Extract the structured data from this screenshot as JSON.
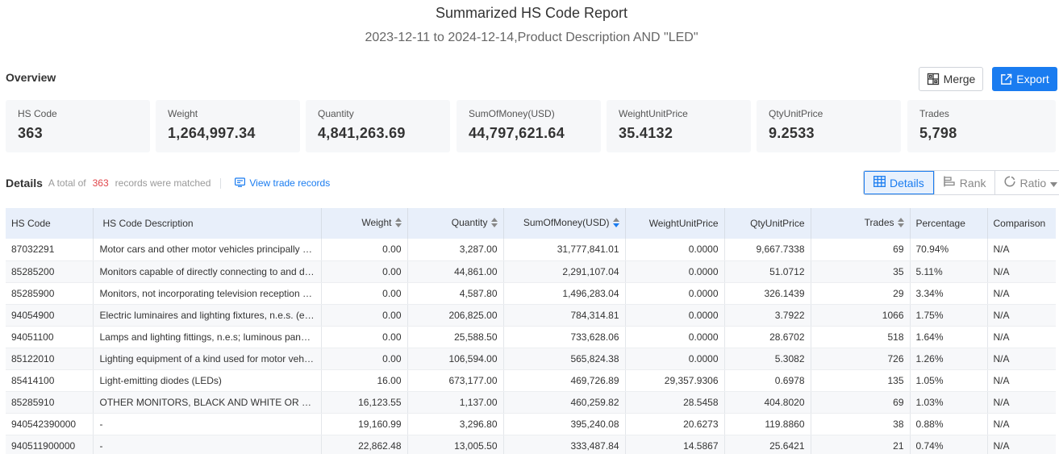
{
  "header": {
    "title": "Summarized HS Code Report",
    "subtitle": "2023-12-11 to 2024-12-14,Product Description AND \"LED\""
  },
  "overview": {
    "label": "Overview",
    "merge_label": "Merge",
    "export_label": "Export",
    "cards": [
      {
        "label": "HS Code",
        "value": "363"
      },
      {
        "label": "Weight",
        "value": "1,264,997.34"
      },
      {
        "label": "Quantity",
        "value": "4,841,263.69"
      },
      {
        "label": "SumOfMoney(USD)",
        "value": "44,797,621.64"
      },
      {
        "label": "WeightUnitPrice",
        "value": "35.4132"
      },
      {
        "label": "QtyUnitPrice",
        "value": "9.2533"
      },
      {
        "label": "Trades",
        "value": "5,798"
      }
    ]
  },
  "details": {
    "label": "Details",
    "total_prefix": "A total of",
    "total_count": "363",
    "total_suffix": "records were matched",
    "view_link": "View trade records",
    "toggle": {
      "details": "Details",
      "rank": "Rank",
      "ratio": "Ratio"
    }
  },
  "table": {
    "columns": [
      "HS Code",
      "HS Code Description",
      "Weight",
      "Quantity",
      "SumOfMoney(USD)",
      "WeightUnitPrice",
      "QtyUnitPrice",
      "Trades",
      "Percentage",
      "Comparison"
    ],
    "rows": [
      [
        "87032291",
        "Motor cars and other motor vehicles principally designed for the transport of persons",
        "0.00",
        "3,287.00",
        "31,777,841.01",
        "0.0000",
        "9,667.7338",
        "69",
        "70.94%",
        "N/A"
      ],
      [
        "85285200",
        "Monitors capable of directly connecting to and designed for use with automatic data",
        "0.00",
        "44,861.00",
        "2,291,107.04",
        "0.0000",
        "51.0712",
        "35",
        "5.11%",
        "N/A"
      ],
      [
        "85285900",
        "Monitors, not incorporating television reception apparatus",
        "0.00",
        "4,587.80",
        "1,496,283.04",
        "0.0000",
        "326.1439",
        "29",
        "3.34%",
        "N/A"
      ],
      [
        "94054900",
        "Electric luminaires and lighting fixtures, n.e.s. (excl. those of heading",
        "0.00",
        "206,825.00",
        "784,314.81",
        "0.0000",
        "3.7922",
        "1066",
        "1.75%",
        "N/A"
      ],
      [
        "94051100",
        "Lamps and lighting fittings, n.e.s; luminous panel of LED",
        "0.00",
        "25,588.50",
        "733,628.06",
        "0.0000",
        "28.6702",
        "518",
        "1.64%",
        "N/A"
      ],
      [
        "85122010",
        "Lighting equipment of a kind used for motor vehicles",
        "0.00",
        "106,594.00",
        "565,824.38",
        "0.0000",
        "5.3082",
        "726",
        "1.26%",
        "N/A"
      ],
      [
        "85414100",
        "Light-emitting diodes (LEDs)",
        "16.00",
        "673,177.00",
        "469,726.89",
        "29,357.9306",
        "0.6978",
        "135",
        "1.05%",
        "N/A"
      ],
      [
        "85285910",
        "OTHER MONITORS, BLACK AND WHITE OR OTHER MONOCHROME",
        "16,123.55",
        "1,137.00",
        "460,259.82",
        "28.5458",
        "404.8020",
        "69",
        "1.03%",
        "N/A"
      ],
      [
        "940542390000",
        "-",
        "19,160.99",
        "3,296.80",
        "395,240.08",
        "20.6273",
        "119.8860",
        "38",
        "0.88%",
        "N/A"
      ],
      [
        "940511900000",
        "-",
        "22,862.48",
        "13,005.50",
        "333,487.84",
        "14.5867",
        "25.6421",
        "21",
        "0.74%",
        "N/A"
      ]
    ]
  },
  "colors": {
    "accent": "#1a7cf0",
    "count": "#e0454a",
    "header_bg": "#e8effa"
  },
  "icons": {
    "merge": "merge-icon",
    "export": "export-icon",
    "view": "record-icon",
    "details": "table-icon",
    "rank": "rank-icon",
    "ratio": "ratio-icon",
    "sort": "sort-icon",
    "dropdown": "caret-down-icon"
  }
}
